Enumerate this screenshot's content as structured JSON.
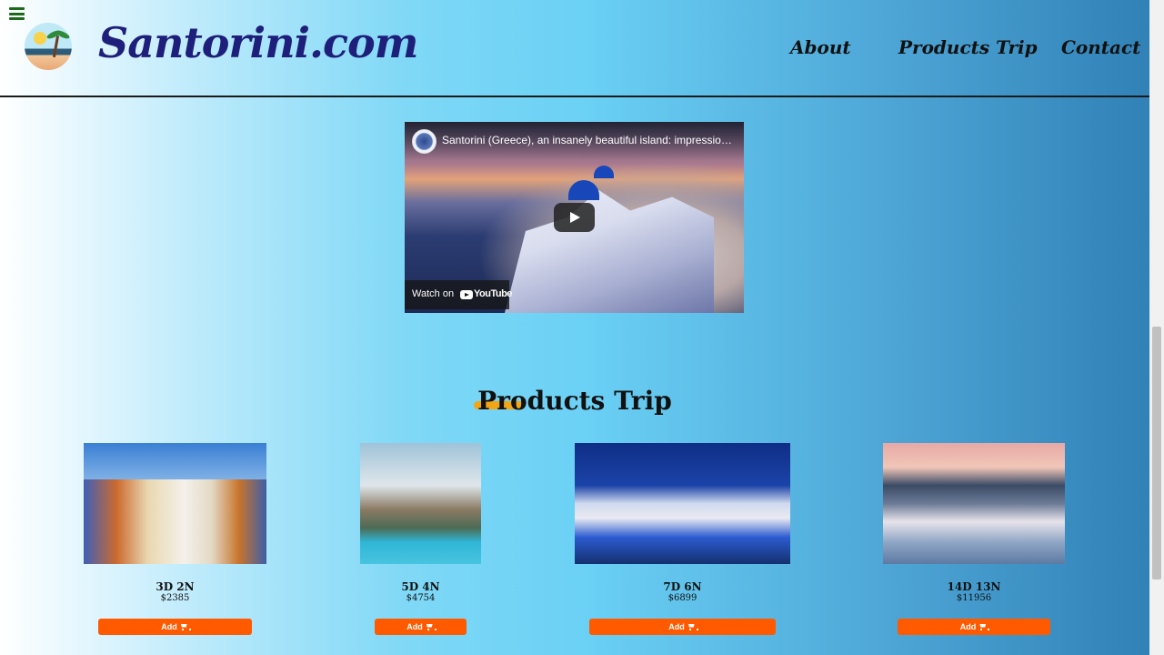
{
  "header": {
    "brand": "Santorini.com",
    "nav": [
      "About",
      "Products Trip",
      "Contact"
    ],
    "menu_icon": "hamburger-menu-icon",
    "logo_icon": "beach-palm-logo-icon"
  },
  "video": {
    "title": "Santorini (Greece), an insanely beautiful island: impressions & highlights",
    "watch_on": "Watch on",
    "platform": "YouTube"
  },
  "products_section": {
    "title": "Products Trip",
    "accent_color": "#f2a516"
  },
  "products": [
    {
      "name": "3D 2N",
      "price": "$2385",
      "button": "Add"
    },
    {
      "name": "5D 4N",
      "price": "$4754",
      "button": "Add"
    },
    {
      "name": "7D 6N",
      "price": "$6899",
      "button": "Add"
    },
    {
      "name": "14D 13N",
      "price": "$11956",
      "button": "Add"
    }
  ],
  "colors": {
    "brand": "#1d1f7a",
    "button": "#ff5a00"
  }
}
